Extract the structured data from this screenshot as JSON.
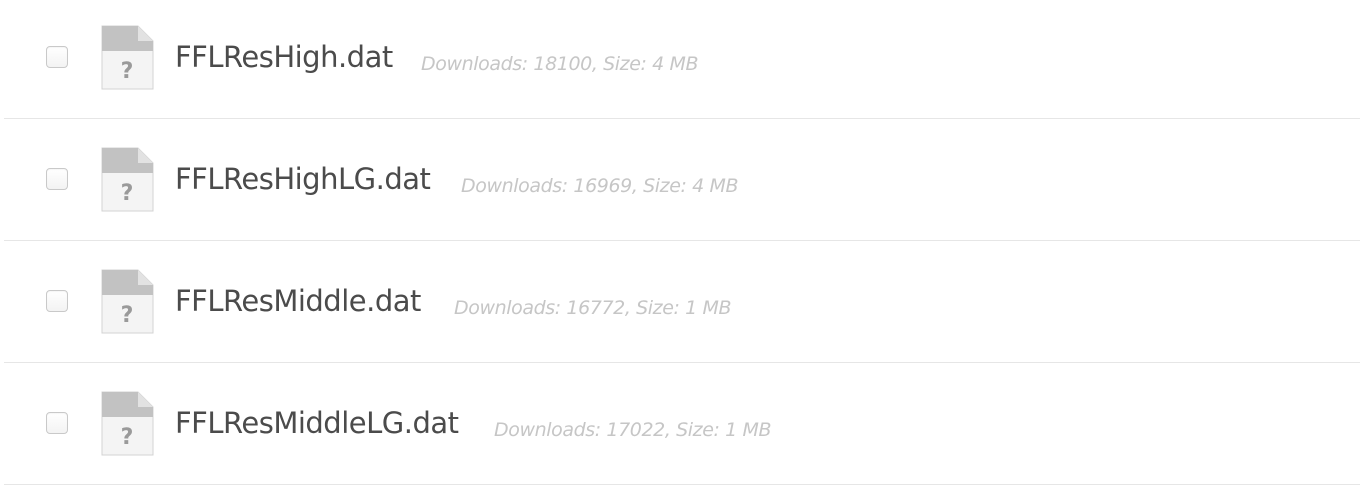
{
  "files": [
    {
      "name": "FFLResHigh.dat",
      "meta": "Downloads: 18100, Size: 4 MB",
      "icon": "unknown-file-icon",
      "checked": false
    },
    {
      "name": "FFLResHighLG.dat",
      "meta": "Downloads: 16969, Size: 4 MB",
      "icon": "unknown-file-icon",
      "checked": false
    },
    {
      "name": "FFLResMiddle.dat",
      "meta": "Downloads: 16772, Size: 1 MB",
      "icon": "unknown-file-icon",
      "checked": false
    },
    {
      "name": "FFLResMiddleLG.dat",
      "meta": "Downloads: 17022, Size: 1 MB",
      "icon": "unknown-file-icon",
      "checked": false
    }
  ],
  "colors": {
    "filename_text": "#4b4b4b",
    "meta_text": "#c6c6c6",
    "row_divider": "#e6e6e6",
    "icon_body": "#f2f2f2",
    "icon_header": "#bdbdbd",
    "icon_glyph": "#9a9a9a"
  }
}
